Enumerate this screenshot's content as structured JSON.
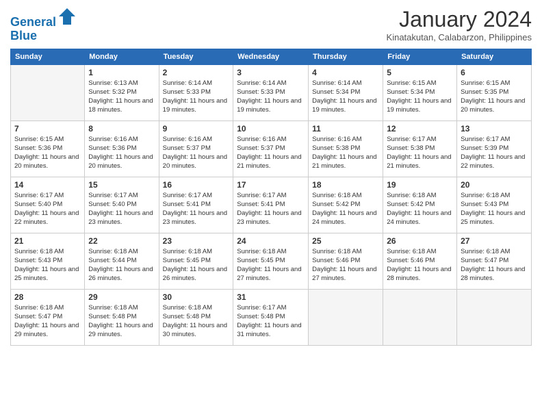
{
  "logo": {
    "line1": "General",
    "line2": "Blue"
  },
  "title": "January 2024",
  "location": "Kinatakutan, Calabarzon, Philippines",
  "weekdays": [
    "Sunday",
    "Monday",
    "Tuesday",
    "Wednesday",
    "Thursday",
    "Friday",
    "Saturday"
  ],
  "weeks": [
    [
      {
        "day": "",
        "empty": true
      },
      {
        "day": "1",
        "sunrise": "6:13 AM",
        "sunset": "5:32 PM",
        "daylight": "11 hours and 18 minutes."
      },
      {
        "day": "2",
        "sunrise": "6:14 AM",
        "sunset": "5:33 PM",
        "daylight": "11 hours and 19 minutes."
      },
      {
        "day": "3",
        "sunrise": "6:14 AM",
        "sunset": "5:33 PM",
        "daylight": "11 hours and 19 minutes."
      },
      {
        "day": "4",
        "sunrise": "6:14 AM",
        "sunset": "5:34 PM",
        "daylight": "11 hours and 19 minutes."
      },
      {
        "day": "5",
        "sunrise": "6:15 AM",
        "sunset": "5:34 PM",
        "daylight": "11 hours and 19 minutes."
      },
      {
        "day": "6",
        "sunrise": "6:15 AM",
        "sunset": "5:35 PM",
        "daylight": "11 hours and 20 minutes."
      }
    ],
    [
      {
        "day": "7",
        "sunrise": "6:15 AM",
        "sunset": "5:36 PM",
        "daylight": "11 hours and 20 minutes."
      },
      {
        "day": "8",
        "sunrise": "6:16 AM",
        "sunset": "5:36 PM",
        "daylight": "11 hours and 20 minutes."
      },
      {
        "day": "9",
        "sunrise": "6:16 AM",
        "sunset": "5:37 PM",
        "daylight": "11 hours and 20 minutes."
      },
      {
        "day": "10",
        "sunrise": "6:16 AM",
        "sunset": "5:37 PM",
        "daylight": "11 hours and 21 minutes."
      },
      {
        "day": "11",
        "sunrise": "6:16 AM",
        "sunset": "5:38 PM",
        "daylight": "11 hours and 21 minutes."
      },
      {
        "day": "12",
        "sunrise": "6:17 AM",
        "sunset": "5:38 PM",
        "daylight": "11 hours and 21 minutes."
      },
      {
        "day": "13",
        "sunrise": "6:17 AM",
        "sunset": "5:39 PM",
        "daylight": "11 hours and 22 minutes."
      }
    ],
    [
      {
        "day": "14",
        "sunrise": "6:17 AM",
        "sunset": "5:40 PM",
        "daylight": "11 hours and 22 minutes."
      },
      {
        "day": "15",
        "sunrise": "6:17 AM",
        "sunset": "5:40 PM",
        "daylight": "11 hours and 23 minutes."
      },
      {
        "day": "16",
        "sunrise": "6:17 AM",
        "sunset": "5:41 PM",
        "daylight": "11 hours and 23 minutes."
      },
      {
        "day": "17",
        "sunrise": "6:17 AM",
        "sunset": "5:41 PM",
        "daylight": "11 hours and 23 minutes."
      },
      {
        "day": "18",
        "sunrise": "6:18 AM",
        "sunset": "5:42 PM",
        "daylight": "11 hours and 24 minutes."
      },
      {
        "day": "19",
        "sunrise": "6:18 AM",
        "sunset": "5:42 PM",
        "daylight": "11 hours and 24 minutes."
      },
      {
        "day": "20",
        "sunrise": "6:18 AM",
        "sunset": "5:43 PM",
        "daylight": "11 hours and 25 minutes."
      }
    ],
    [
      {
        "day": "21",
        "sunrise": "6:18 AM",
        "sunset": "5:43 PM",
        "daylight": "11 hours and 25 minutes."
      },
      {
        "day": "22",
        "sunrise": "6:18 AM",
        "sunset": "5:44 PM",
        "daylight": "11 hours and 26 minutes."
      },
      {
        "day": "23",
        "sunrise": "6:18 AM",
        "sunset": "5:45 PM",
        "daylight": "11 hours and 26 minutes."
      },
      {
        "day": "24",
        "sunrise": "6:18 AM",
        "sunset": "5:45 PM",
        "daylight": "11 hours and 27 minutes."
      },
      {
        "day": "25",
        "sunrise": "6:18 AM",
        "sunset": "5:46 PM",
        "daylight": "11 hours and 27 minutes."
      },
      {
        "day": "26",
        "sunrise": "6:18 AM",
        "sunset": "5:46 PM",
        "daylight": "11 hours and 28 minutes."
      },
      {
        "day": "27",
        "sunrise": "6:18 AM",
        "sunset": "5:47 PM",
        "daylight": "11 hours and 28 minutes."
      }
    ],
    [
      {
        "day": "28",
        "sunrise": "6:18 AM",
        "sunset": "5:47 PM",
        "daylight": "11 hours and 29 minutes."
      },
      {
        "day": "29",
        "sunrise": "6:18 AM",
        "sunset": "5:48 PM",
        "daylight": "11 hours and 29 minutes."
      },
      {
        "day": "30",
        "sunrise": "6:18 AM",
        "sunset": "5:48 PM",
        "daylight": "11 hours and 30 minutes."
      },
      {
        "day": "31",
        "sunrise": "6:17 AM",
        "sunset": "5:48 PM",
        "daylight": "11 hours and 31 minutes."
      },
      {
        "day": "",
        "empty": true
      },
      {
        "day": "",
        "empty": true
      },
      {
        "day": "",
        "empty": true
      }
    ]
  ]
}
